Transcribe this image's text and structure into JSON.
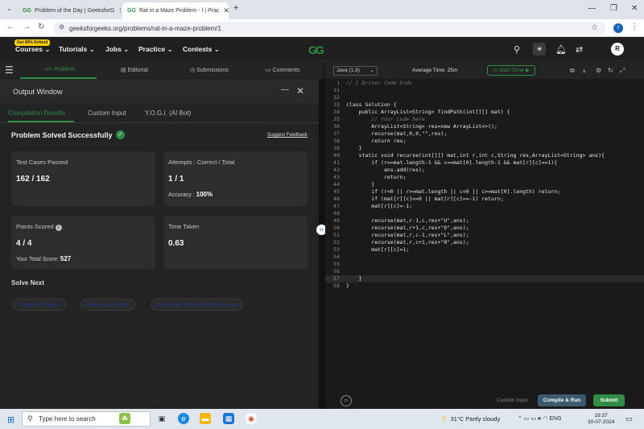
{
  "browser": {
    "tabs": [
      {
        "title": "Problem of the Day | GeeksforG",
        "active": false
      },
      {
        "title": "Rat in a Maze Problem - I | Prac",
        "active": true
      }
    ],
    "url": "geeksforgeeks.org/problems/rat-in-a-maze-problem/1",
    "profile_initial": "I"
  },
  "navbar": {
    "badge": "Get 90% Refund",
    "items": [
      "Courses",
      "Tutorials",
      "Jobs",
      "Practice",
      "Contests"
    ],
    "logo": "GG",
    "avatar": "R"
  },
  "subnav": {
    "tabs": [
      "</> Problem",
      "Editorial",
      "Submissions",
      "Comments"
    ],
    "active": "</> Problem"
  },
  "output": {
    "title": "Output Window",
    "tabs": [
      "Compilation Results",
      "Custom Input",
      "Y.O.G.I. (AI Bot)"
    ],
    "status": "Problem Solved Successfully",
    "feedback": "Suggest Feedback",
    "cards": {
      "test_cases_label": "Test Cases Passed",
      "test_cases_value": "162 / 162",
      "attempts_label": "Attempts : Correct / Total",
      "attempts_value": "1 / 1",
      "accuracy_label": "Accuracy :",
      "accuracy_value": "100%",
      "points_label": "Points Scored",
      "points_value": "4 / 4",
      "total_score_label": "Your Total Score:",
      "total_score_value": "527",
      "time_label": "Time Taken",
      "time_value": "0.63"
    },
    "solve_next_title": "Solve Next",
    "solve_next": [
      "Tower Of Hanoi",
      "Black and White",
      "Rat Maze With Multiple Jumps"
    ]
  },
  "editor": {
    "language": "Java (1.8)",
    "avg_time": "Average Time: 25m",
    "timer": "Start Timer",
    "lines": [
      {
        "n": "1",
        "text": "// } Driver Code Ends"
      },
      {
        "n": "31",
        "text": ""
      },
      {
        "n": "32",
        "text": ""
      },
      {
        "n": "33",
        "text": "class Solution {"
      },
      {
        "n": "34",
        "text": "    public ArrayList<String> findPath(int[][] mat) {"
      },
      {
        "n": "35",
        "text": "        // Your code here"
      },
      {
        "n": "36",
        "text": "        ArrayList<String> res=new ArrayList<>();"
      },
      {
        "n": "37",
        "text": "        recurse(mat,0,0,\"\",res);"
      },
      {
        "n": "38",
        "text": "        return res;"
      },
      {
        "n": "39",
        "text": "    }"
      },
      {
        "n": "40",
        "text": "    static void recurse(int[][] mat,int r,int c,String res,ArrayList<String> ans){"
      },
      {
        "n": "41",
        "text": "        if (r==mat.length-1 && c==mat[0].length-1 && mat[r][c]==1){"
      },
      {
        "n": "42",
        "text": "            ans.add(res);"
      },
      {
        "n": "43",
        "text": "            return;"
      },
      {
        "n": "44",
        "text": "        }"
      },
      {
        "n": "45",
        "text": "        if (r<0 || r>=mat.length || c<0 || c>=mat[0].length) return;"
      },
      {
        "n": "46",
        "text": "        if (mat[r][c]==0 || mat[r][c]==-1) return;"
      },
      {
        "n": "47",
        "text": "        mat[r][c]=-1;"
      },
      {
        "n": "48",
        "text": ""
      },
      {
        "n": "49",
        "text": "        recurse(mat,r-1,c,res+\"U\",ans);"
      },
      {
        "n": "50",
        "text": "        recurse(mat,r+1,c,res+\"D\",ans);"
      },
      {
        "n": "51",
        "text": "        recurse(mat,r,c-1,res+\"L\",ans);"
      },
      {
        "n": "52",
        "text": "        recurse(mat,r,c+1,res+\"R\",ans);"
      },
      {
        "n": "53",
        "text": "        mat[r][c]=1;"
      },
      {
        "n": "54",
        "text": ""
      },
      {
        "n": "55",
        "text": ""
      },
      {
        "n": "56",
        "text": ""
      },
      {
        "n": "57",
        "text": "    }"
      },
      {
        "n": "58",
        "text": "}"
      }
    ],
    "custom_input": "Custom Input",
    "compile_run": "Compile & Run",
    "submit": "Submit"
  },
  "taskbar": {
    "search_placeholder": "Type here to search",
    "weather": "31°C  Partly cloudy",
    "language": "ENG",
    "time": "19:37",
    "date": "30-07-2024"
  },
  "colors": {
    "accent_green": "#2f8d46",
    "chip_text": "#1e3a8a",
    "panel_bg": "#232323"
  }
}
